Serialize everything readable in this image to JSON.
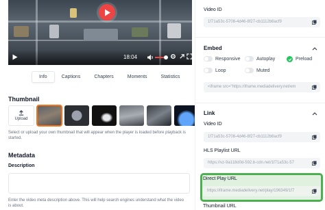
{
  "player": {
    "time": "18:04",
    "tabs": [
      "Info",
      "Captions",
      "Chapters",
      "Moments",
      "Statistics"
    ]
  },
  "info": {
    "thumbnail_title": "Thumbnail",
    "upload_label": "Upload",
    "thumbnail_help": "Select or upload your own thumbnail that will appear when the player is loaded before playback is started.",
    "metadata_title": "Metadata",
    "description_label": "Description",
    "description_value": "",
    "description_help": "Enter the video meta description above. This will help search engines understand what the video is about."
  },
  "sidebar": {
    "video_id_label": "Video ID",
    "video_id_value": "1f71a53c-5708-4d46-8f27-cb1112b6acf9",
    "embed": {
      "title": "Embed",
      "options": [
        {
          "label": "Responsive",
          "on": false
        },
        {
          "label": "Autoplay",
          "on": false
        },
        {
          "label": "Preload",
          "on": true
        },
        {
          "label": "Loop",
          "on": false
        },
        {
          "label": "Muted",
          "on": false
        }
      ],
      "code": "<iframe src=\"https://iframe.mediadelivery.net/em"
    },
    "link": {
      "title": "Link",
      "video_id_label": "Video ID",
      "video_id_value": "1f71a53c-5708-4d46-8f27-cb1112b6acf9",
      "hls_label": "HLS Playlist URL",
      "hls_value": "https://vz-9a118d0d-592.b-cdn.net/1f71a53c-57",
      "direct_label": "Direct Play URL",
      "direct_value": "https://iframe.mediadelivery.net/play/196349/1f7",
      "thumbnail_label": "Thumbnail URL"
    }
  },
  "colors": {
    "accent_red": "#ef4444",
    "highlight_green": "#4caf50",
    "check_green": "#22c55e",
    "selected_thumb": "#f97316"
  }
}
